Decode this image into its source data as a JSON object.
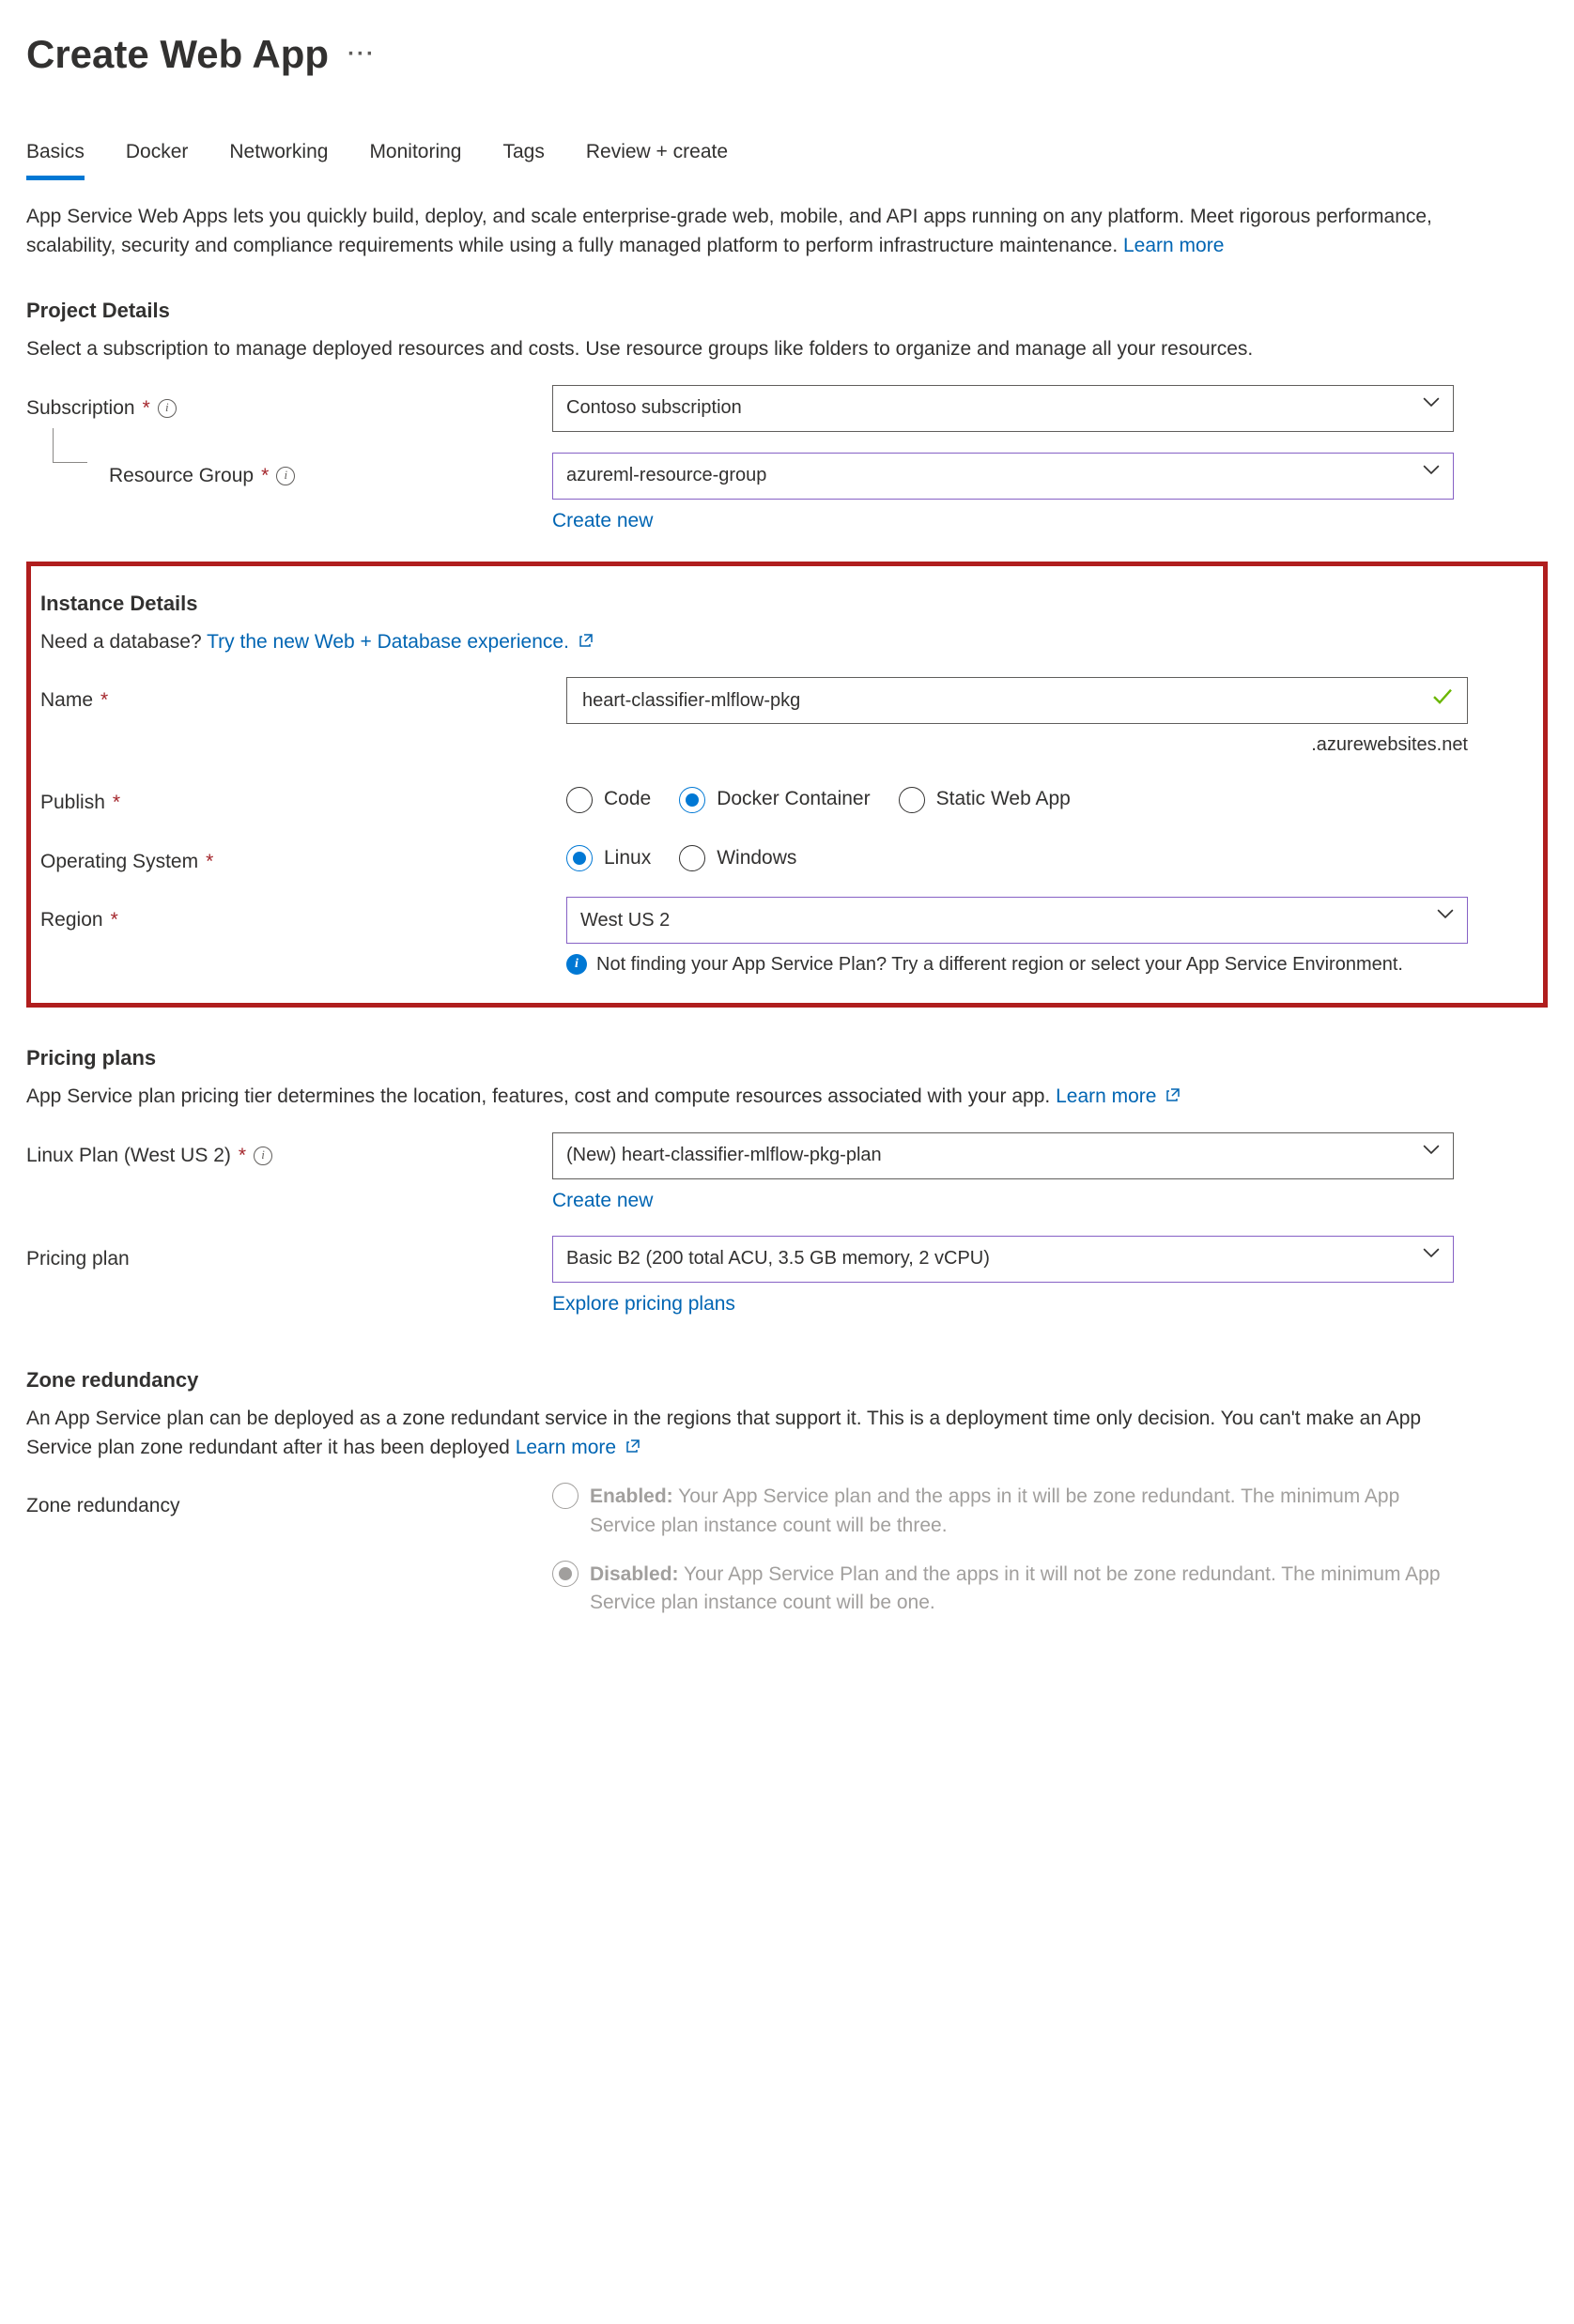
{
  "header": {
    "title": "Create Web App"
  },
  "tabs": [
    "Basics",
    "Docker",
    "Networking",
    "Monitoring",
    "Tags",
    "Review + create"
  ],
  "intro": {
    "text": "App Service Web Apps lets you quickly build, deploy, and scale enterprise-grade web, mobile, and API apps running on any platform. Meet rigorous performance, scalability, security and compliance requirements while using a fully managed platform to perform infrastructure maintenance.  ",
    "learn_more": "Learn more"
  },
  "project": {
    "heading": "Project Details",
    "desc": "Select a subscription to manage deployed resources and costs. Use resource groups like folders to organize and manage all your resources.",
    "subscription_label": "Subscription",
    "subscription_value": "Contoso subscription",
    "resource_group_label": "Resource Group",
    "resource_group_value": "azureml-resource-group",
    "create_new": "Create new"
  },
  "instance": {
    "heading": "Instance Details",
    "db_prompt": "Need a database? ",
    "db_link": "Try the new Web + Database experience.",
    "name_label": "Name",
    "name_value": "heart-classifier-mlflow-pkg",
    "name_suffix": ".azurewebsites.net",
    "publish_label": "Publish",
    "publish_options": [
      "Code",
      "Docker Container",
      "Static Web App"
    ],
    "publish_selected": "Docker Container",
    "os_label": "Operating System",
    "os_options": [
      "Linux",
      "Windows"
    ],
    "os_selected": "Linux",
    "region_label": "Region",
    "region_value": "West US 2",
    "region_hint": "Not finding your App Service Plan? Try a different region or select your App Service Environment."
  },
  "pricing": {
    "heading": "Pricing plans",
    "desc": "App Service plan pricing tier determines the location, features, cost and compute resources associated with your app. ",
    "learn_more": "Learn more",
    "plan_label": "Linux Plan (West US 2)",
    "plan_value": "(New) heart-classifier-mlflow-pkg-plan",
    "create_new": "Create new",
    "tier_label": "Pricing plan",
    "tier_value": "Basic B2 (200 total ACU, 3.5 GB memory, 2 vCPU)",
    "explore": "Explore pricing plans"
  },
  "zone": {
    "heading": "Zone redundancy",
    "desc": "An App Service plan can be deployed as a zone redundant service in the regions that support it. This is a deployment time only decision. You can't make an App Service plan zone redundant after it has been deployed ",
    "learn_more": "Learn more",
    "label": "Zone redundancy",
    "enabled_title": "Enabled:",
    "enabled_desc": " Your App Service plan and the apps in it will be zone redundant. The minimum App Service plan instance count will be three.",
    "disabled_title": "Disabled:",
    "disabled_desc": " Your App Service Plan and the apps in it will not be zone redundant. The minimum App Service plan instance count will be one.",
    "selected": "Disabled"
  }
}
